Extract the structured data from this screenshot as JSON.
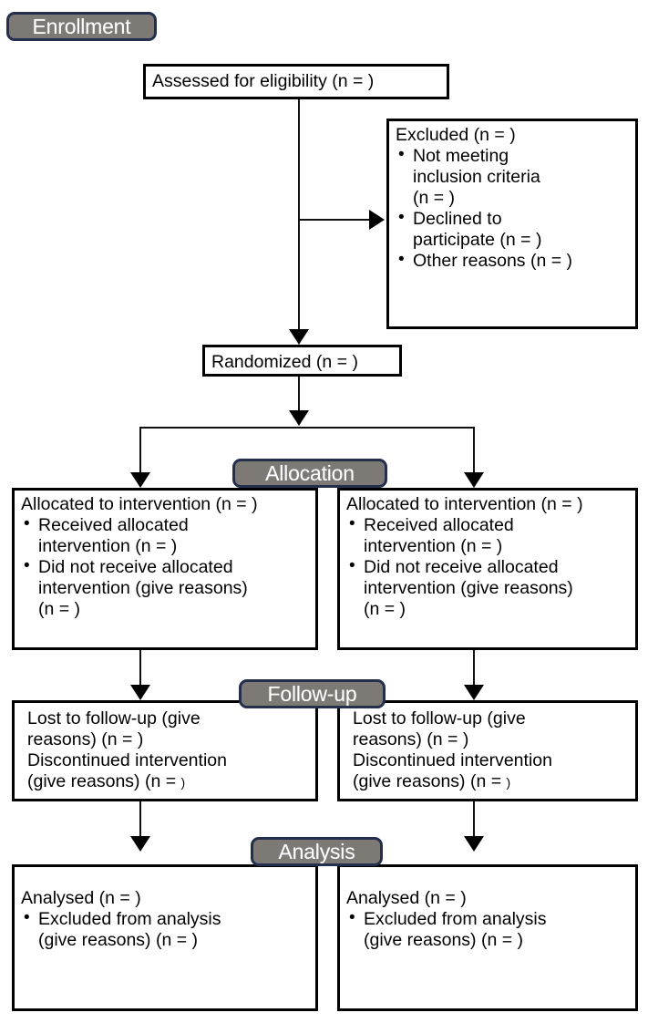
{
  "diagram": {
    "title": "CONSORT participant flow diagram",
    "colors": {
      "badge_fill": "#7d7a76",
      "badge_border": "#242f4d",
      "badge_text": "#ffffff",
      "box_border": "#000000",
      "box_fill": "#ffffff",
      "connector": "#111111",
      "text": "#000000"
    }
  },
  "stages": {
    "enrollment": "Enrollment",
    "allocation": "Allocation",
    "followup": "Follow-up",
    "analysis": "Analysis"
  },
  "boxes": {
    "assessed": {
      "text": "Assessed for eligibility (n =  )"
    },
    "excluded": {
      "heading": "Excluded (n =  )",
      "bullets": [
        {
          "line1": "Not meeting",
          "line2": "inclusion criteria",
          "line3": "(n = )"
        },
        {
          "line1": "Declined to",
          "line2": "participate (n =  )"
        },
        {
          "line1": "Other reasons (n =  )"
        }
      ]
    },
    "randomized": {
      "text": "Randomized (n =  )"
    },
    "allocation_left": {
      "heading": "Allocated to intervention (n =  )",
      "bullets": [
        {
          "line1": "Received allocated",
          "line2": "intervention (n = )"
        },
        {
          "line1": "Did not receive allocated",
          "line2": "intervention (give reasons)",
          "line3": "(n =  )"
        }
      ]
    },
    "allocation_right": {
      "heading": "Allocated to intervention (n =  )",
      "bullets": [
        {
          "line1": "Received allocated",
          "line2": "intervention (n = )"
        },
        {
          "line1": "Did not receive allocated",
          "line2": "intervention (give reasons)",
          "line3": "(n =  )"
        }
      ]
    },
    "followup_left": {
      "line1": "Lost to follow-up (give",
      "line2": "reasons) (n =  )",
      "line3": "Discontinued intervention",
      "line4a": "(give reasons) (n = ",
      "line4b": ")"
    },
    "followup_right": {
      "line1": "Lost to follow-up (give",
      "line2": "reasons) (n =  )",
      "line3": "Discontinued intervention",
      "line4a": "(give reasons) (n = ",
      "line4b": ")"
    },
    "analysis_left": {
      "heading": "Analysed (n =  )",
      "bullets": [
        {
          "line1": "Excluded from analysis",
          "line2": "(give reasons) (n = )"
        }
      ]
    },
    "analysis_right": {
      "heading": "Analysed (n =  )",
      "bullets": [
        {
          "line1": "Excluded from analysis",
          "line2": "(give reasons) (n = )"
        }
      ]
    }
  }
}
